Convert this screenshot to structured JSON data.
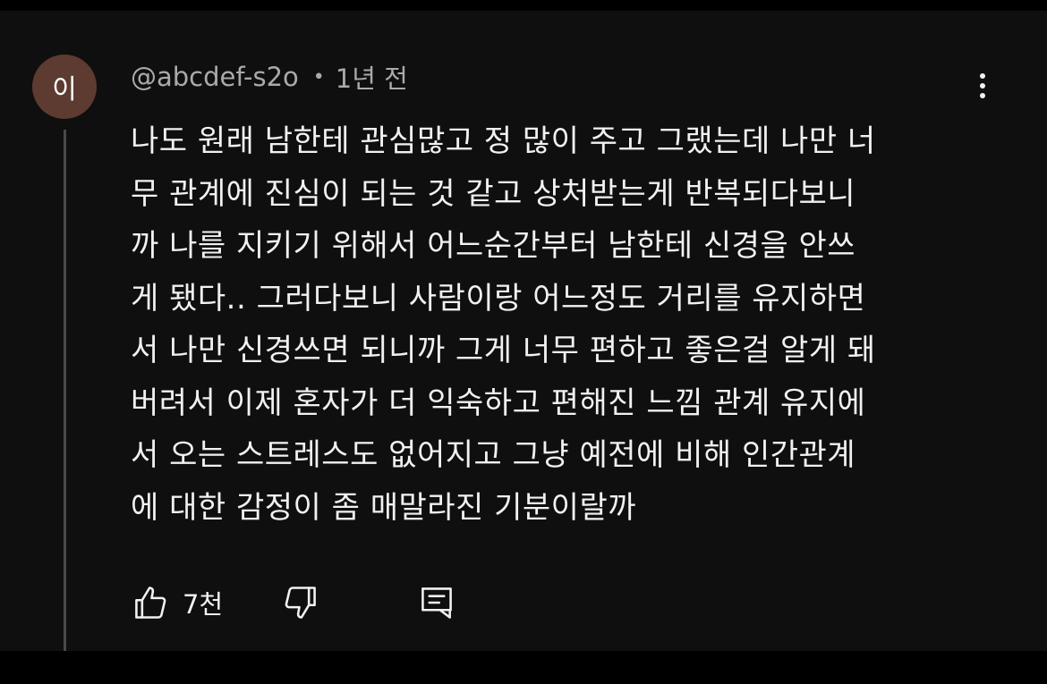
{
  "comment": {
    "avatar_initial": "이",
    "author": "@abcdef-s2o",
    "separator": "•",
    "time": "1년 전",
    "text": "나도 원래 남한테 관심많고 정 많이 주고 그랬는데 나만 너\n무 관계에 진심이 되는 것 같고 상처받는게 반복되다보니\n까 나를 지키기 위해서 어느순간부터 남한테 신경을 안쓰\n게 됐다.. 그러다보니 사람이랑 어느정도 거리를 유지하면\n서 나만 신경쓰면 되니까 그게 너무 편하고 좋은걸 알게 돼\n버려서 이제 혼자가 더 익숙하고 편해진 느낌 관계 유지에\n서 오는 스트레스도 없어지고 그냥 예전에 비해 인간관계\n에 대한 감정이 좀 매말라진 기분이랄까",
    "like_count": "7천"
  },
  "icons": {
    "more": "more-vertical-icon",
    "like": "thumbs-up-icon",
    "dislike": "thumbs-down-icon",
    "reply": "reply-comment-icon"
  },
  "colors": {
    "page_border": "#000000",
    "background": "#0f0f0f",
    "avatar": "#5d3b31",
    "text_primary": "#f1f1f1",
    "text_secondary": "#aaaaaa",
    "thread_line": "#4a4a4a"
  }
}
